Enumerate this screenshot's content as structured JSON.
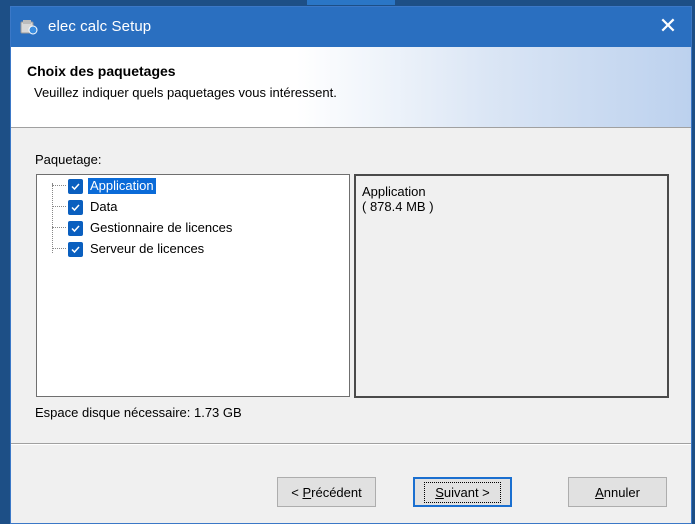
{
  "window": {
    "title": "elec calc Setup",
    "close_glyph": "✕"
  },
  "header": {
    "title": "Choix des paquetages",
    "subtitle": "Veuillez indiquer quels paquetages vous intéressent."
  },
  "packages_label": "Paquetage:",
  "packages": [
    {
      "label": "Application",
      "checked": true,
      "selected": true
    },
    {
      "label": "Data",
      "checked": true,
      "selected": false
    },
    {
      "label": "Gestionnaire de licences",
      "checked": true,
      "selected": false
    },
    {
      "label": "Serveur de licences",
      "checked": true,
      "selected": false
    }
  ],
  "info": {
    "name": "Application",
    "size": "( 878.4 MB )"
  },
  "disk_space": "Espace disque nécessaire: 1.73 GB",
  "buttons": {
    "back": {
      "prefix": "< ",
      "accel": "P",
      "rest": "récédent"
    },
    "next": {
      "accel": "S",
      "rest": "uivant >"
    },
    "cancel": {
      "accel": "A",
      "pre": "",
      "rest": "nnuler"
    }
  },
  "colors": {
    "titlebar": "#2a6fc0",
    "checkbox": "#0a5fbf",
    "selection": "#0a6bd8"
  }
}
